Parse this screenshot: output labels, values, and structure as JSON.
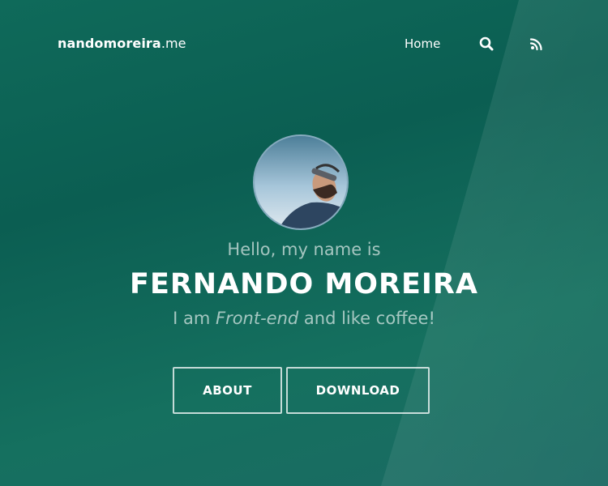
{
  "nav": {
    "brand_bold": "nandomoreira",
    "brand_tld": ".me",
    "home_label": "Home",
    "search_icon": "search-icon",
    "rss_icon": "rss-icon"
  },
  "hero": {
    "greeting": "Hello, my name is",
    "name": "FERNANDO MOREIRA",
    "tagline_prefix": "I am ",
    "tagline_role": "Front-end",
    "tagline_suffix": " and like coffee!",
    "buttons": {
      "about": "ABOUT",
      "download": "DOWNLOAD"
    }
  },
  "colors": {
    "background": "#0b5e52",
    "text": "#ffffff",
    "muted_text": "rgba(255,255,255,0.62)"
  }
}
